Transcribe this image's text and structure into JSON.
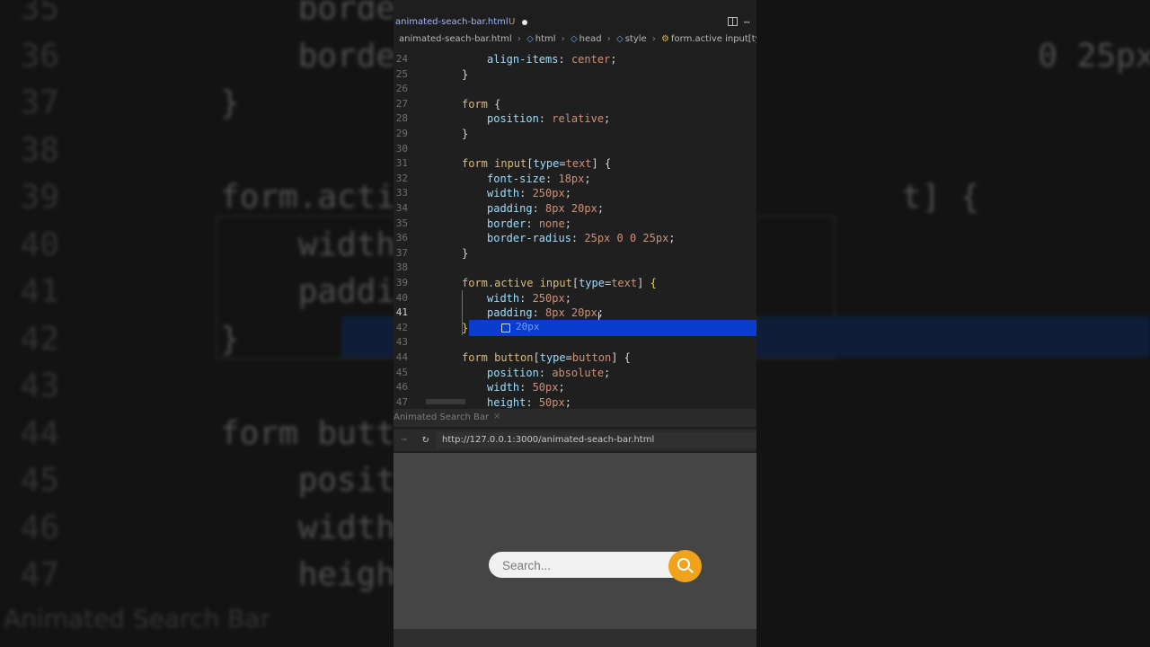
{
  "editor_tab": {
    "filename": "animated-seach-bar.html",
    "git_status": "U"
  },
  "breadcrumb": {
    "file": "animated-seach-bar.html",
    "html": "html",
    "head": "head",
    "style": "style",
    "selector": "form.active input[ty"
  },
  "code_lines": [
    {
      "num": "24",
      "indent": 2,
      "tokens": [
        [
          "prop",
          "align-items"
        ],
        [
          "punc",
          ": "
        ],
        [
          "val",
          "center"
        ],
        [
          "punc",
          ";"
        ]
      ]
    },
    {
      "num": "25",
      "indent": 1,
      "tokens": [
        [
          "punc",
          "}"
        ]
      ]
    },
    {
      "num": "26",
      "indent": 0,
      "tokens": []
    },
    {
      "num": "27",
      "indent": 1,
      "tokens": [
        [
          "sel",
          "form "
        ],
        [
          "punc",
          "{"
        ]
      ]
    },
    {
      "num": "28",
      "indent": 2,
      "tokens": [
        [
          "prop",
          "position"
        ],
        [
          "punc",
          ": "
        ],
        [
          "val",
          "relative"
        ],
        [
          "punc",
          ";"
        ]
      ]
    },
    {
      "num": "29",
      "indent": 1,
      "tokens": [
        [
          "punc",
          "}"
        ]
      ]
    },
    {
      "num": "30",
      "indent": 0,
      "tokens": []
    },
    {
      "num": "31",
      "indent": 1,
      "tokens": [
        [
          "sel",
          "form input"
        ],
        [
          "punc",
          "["
        ],
        [
          "attr",
          "type"
        ],
        [
          "punc",
          "="
        ],
        [
          "attrv",
          "text"
        ],
        [
          "punc",
          "] {"
        ]
      ]
    },
    {
      "num": "32",
      "indent": 2,
      "tokens": [
        [
          "prop",
          "font-size"
        ],
        [
          "punc",
          ": "
        ],
        [
          "val",
          "18px"
        ],
        [
          "punc",
          ";"
        ]
      ]
    },
    {
      "num": "33",
      "indent": 2,
      "tokens": [
        [
          "prop",
          "width"
        ],
        [
          "punc",
          ": "
        ],
        [
          "val",
          "250px"
        ],
        [
          "punc",
          ";"
        ]
      ]
    },
    {
      "num": "34",
      "indent": 2,
      "tokens": [
        [
          "prop",
          "padding"
        ],
        [
          "punc",
          ": "
        ],
        [
          "val",
          "8px 20px"
        ],
        [
          "punc",
          ";"
        ]
      ]
    },
    {
      "num": "35",
      "indent": 2,
      "tokens": [
        [
          "prop",
          "border"
        ],
        [
          "punc",
          ": "
        ],
        [
          "val",
          "none"
        ],
        [
          "punc",
          ";"
        ]
      ]
    },
    {
      "num": "36",
      "indent": 2,
      "tokens": [
        [
          "prop",
          "border-radius"
        ],
        [
          "punc",
          ": "
        ],
        [
          "val",
          "25px 0 0 25px"
        ],
        [
          "punc",
          ";"
        ]
      ]
    },
    {
      "num": "37",
      "indent": 1,
      "tokens": [
        [
          "punc",
          "}"
        ]
      ]
    },
    {
      "num": "38",
      "indent": 0,
      "tokens": []
    },
    {
      "num": "39",
      "indent": 1,
      "tokens": [
        [
          "sel",
          "form.active input"
        ],
        [
          "punc",
          "["
        ],
        [
          "attr",
          "type"
        ],
        [
          "punc",
          "="
        ],
        [
          "attrv",
          "text"
        ],
        [
          "punc",
          "] "
        ],
        [
          "brk",
          "{"
        ]
      ]
    },
    {
      "num": "40",
      "indent": 2,
      "tokens": [
        [
          "prop",
          "width"
        ],
        [
          "punc",
          ": "
        ],
        [
          "val",
          "250px"
        ],
        [
          "punc",
          ";"
        ]
      ]
    },
    {
      "num": "41",
      "indent": 2,
      "tokens": [
        [
          "prop",
          "padding"
        ],
        [
          "punc",
          ": "
        ],
        [
          "val",
          "8px 20px"
        ],
        [
          "punc",
          ";"
        ]
      ]
    },
    {
      "num": "42",
      "indent": 1,
      "tokens": [
        [
          "brk",
          "}"
        ]
      ]
    },
    {
      "num": "43",
      "indent": 0,
      "tokens": []
    },
    {
      "num": "44",
      "indent": 1,
      "tokens": [
        [
          "sel",
          "form button"
        ],
        [
          "punc",
          "["
        ],
        [
          "attr",
          "type"
        ],
        [
          "punc",
          "="
        ],
        [
          "attrv",
          "button"
        ],
        [
          "punc",
          "] {"
        ]
      ]
    },
    {
      "num": "45",
      "indent": 2,
      "tokens": [
        [
          "prop",
          "position"
        ],
        [
          "punc",
          ": "
        ],
        [
          "val",
          "absolute"
        ],
        [
          "punc",
          ";"
        ]
      ]
    },
    {
      "num": "46",
      "indent": 2,
      "tokens": [
        [
          "prop",
          "width"
        ],
        [
          "punc",
          ": "
        ],
        [
          "val",
          "50px"
        ],
        [
          "punc",
          ";"
        ]
      ]
    },
    {
      "num": "47",
      "indent": 2,
      "tokens": [
        [
          "prop",
          "height"
        ],
        [
          "punc",
          ": "
        ],
        [
          "val",
          "50px"
        ],
        [
          "punc",
          ";"
        ]
      ]
    }
  ],
  "current_line": "41",
  "suggestion": "20px",
  "preview": {
    "tab_title": "Animated Search Bar",
    "url": "http://127.0.0.1:3000/animated-seach-bar.html",
    "search_placeholder": "Search..."
  },
  "background": {
    "lines": [
      {
        "num": "35",
        "text": "    borde"
      },
      {
        "num": "36",
        "text": "    borde                                 0 25px;"
      },
      {
        "num": "37",
        "text": "}"
      },
      {
        "num": "38",
        "text": ""
      },
      {
        "num": "39",
        "text": "form.acti                          t] {"
      },
      {
        "num": "40",
        "text": "    width"
      },
      {
        "num": "41",
        "text": "    paddi"
      },
      {
        "num": "42",
        "text": "}"
      },
      {
        "num": "43",
        "text": ""
      },
      {
        "num": "44",
        "text": "form butt"
      },
      {
        "num": "45",
        "text": "    posit"
      },
      {
        "num": "46",
        "text": "    width"
      },
      {
        "num": "47",
        "text": "    heigh"
      }
    ],
    "tab_title": "Animated Search Bar"
  }
}
